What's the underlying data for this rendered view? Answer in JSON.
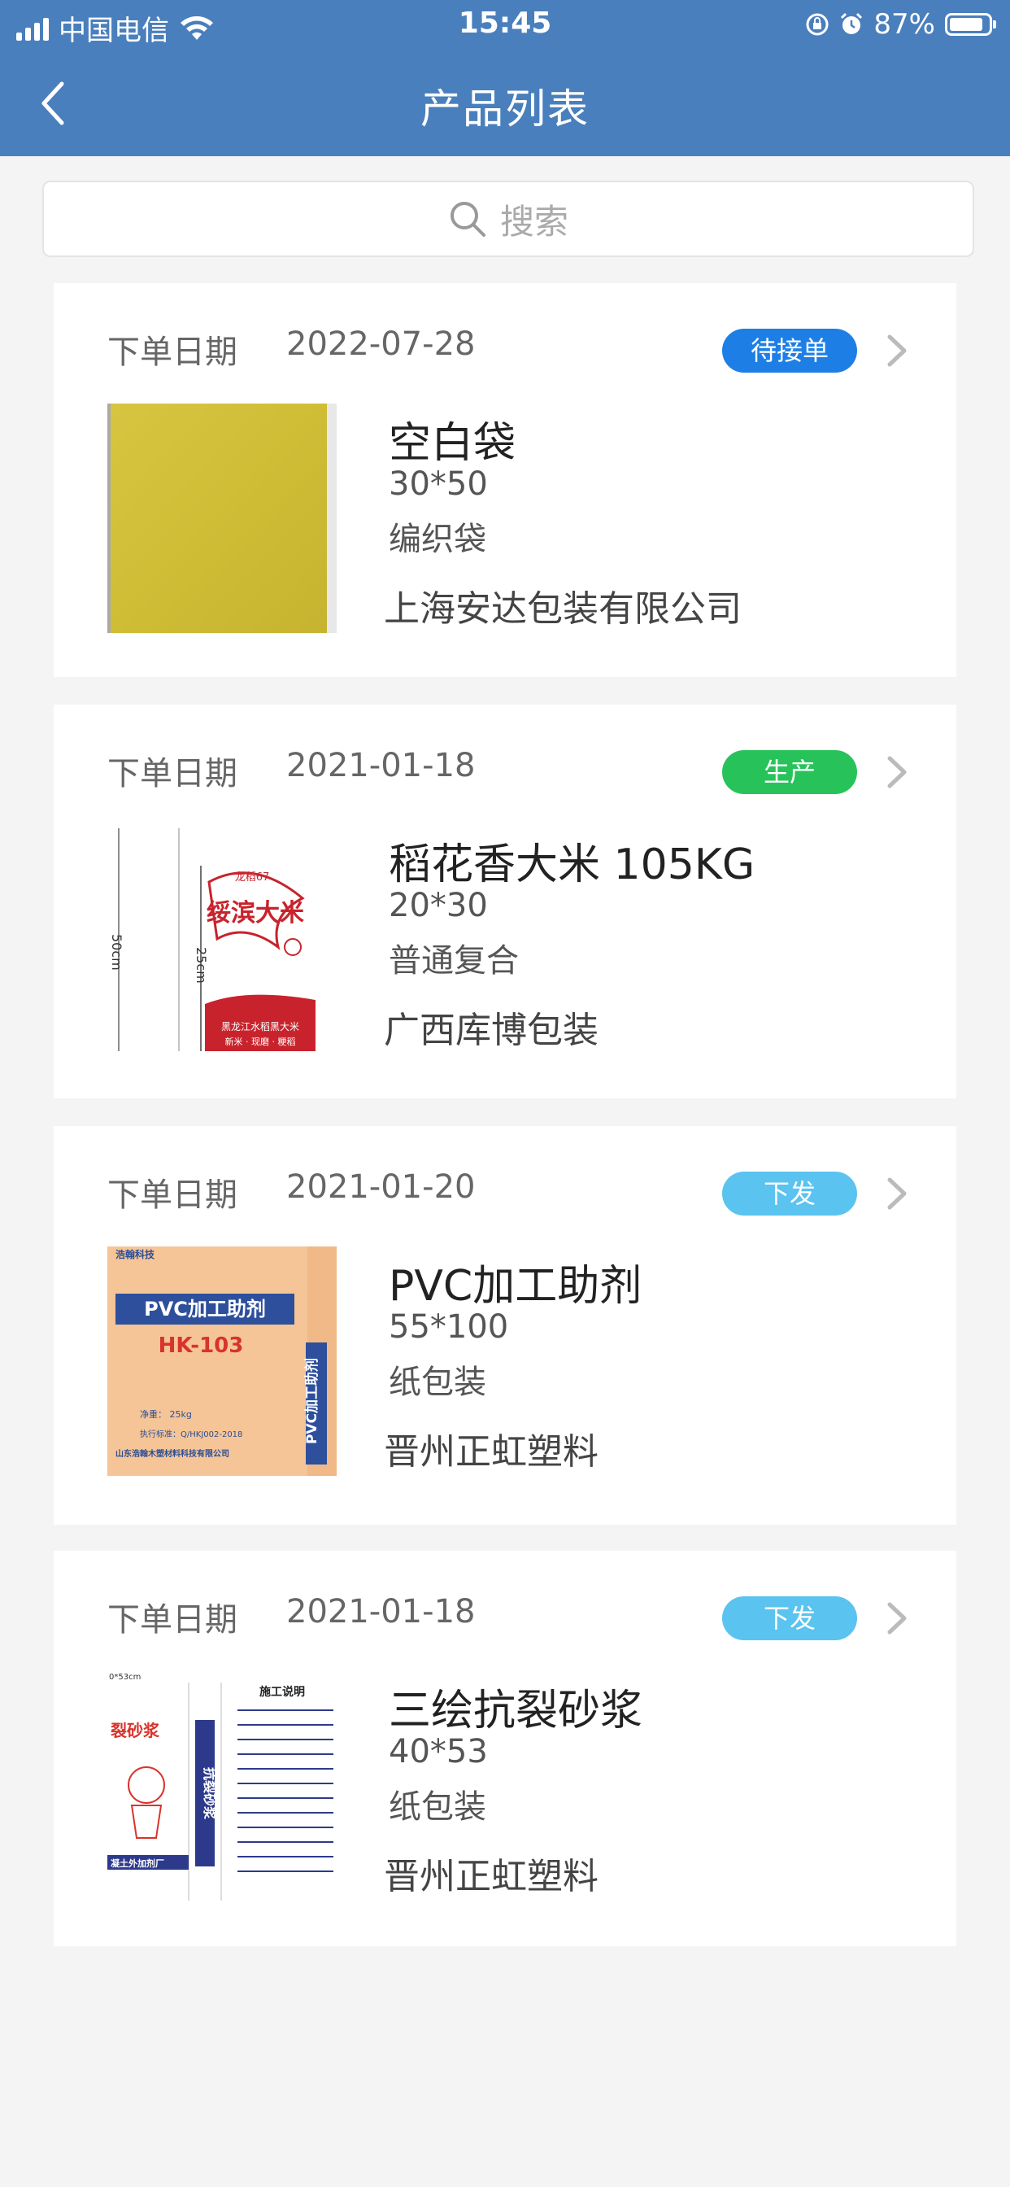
{
  "status_bar": {
    "carrier": "中国电信",
    "time": "15:45",
    "battery": "87%",
    "battery_level": 0.87
  },
  "nav": {
    "title": "产品列表"
  },
  "search": {
    "placeholder": "搜索"
  },
  "colors": {
    "header": "#4a7fbd",
    "badge_pending": "#1d7fe6",
    "badge_production": "#27c35a",
    "badge_dispatch": "#5ac3ef"
  },
  "orders": [
    {
      "date_label": "下单日期",
      "date": "2022-07-28",
      "status": "待接单",
      "name": "空白袋",
      "size": "30*50",
      "type": "编织袋",
      "company": "上海安达包装有限公司"
    },
    {
      "date_label": "下单日期",
      "date": "2021-01-18",
      "status": "生产",
      "name": "稻花香大米 105KG",
      "size": "20*30",
      "type": "普通复合",
      "company": "广西库博包装",
      "thumb_text": {
        "dim_outer": "50cm",
        "dim_inner": "25cm",
        "brand": "绥滨大米",
        "brand_top": "龙稻67",
        "footer": "黑龙江水稻黑大米",
        "footer2": "新米 · 现磨 · 粳稻"
      }
    },
    {
      "date_label": "下单日期",
      "date": "2021-01-20",
      "status": "下发",
      "name": "PVC加工助剂",
      "size": "55*100",
      "type": "纸包装",
      "company": "晋州正虹塑料",
      "thumb_text": {
        "brand": "浩翰科技",
        "title": "PVC加工助剂",
        "model": "HK-103",
        "weight": "净重： 25kg",
        "standard": "执行标准：Q/HKJ002-2018",
        "maker": "山东浩翰木塑材料科技有限公司",
        "side": "PVC加工助剂"
      }
    },
    {
      "date_label": "下单日期",
      "date": "2021-01-18",
      "status": "下发",
      "name": "三绘抗裂砂浆",
      "size": "40*53",
      "type": "纸包装",
      "company": "晋州正虹塑料",
      "thumb_text": {
        "dim": "0*53cm",
        "heading": "施工说明",
        "left": "裂砂浆",
        "vertical": "抗裂砂浆",
        "bottom": "凝土外加剂厂"
      }
    }
  ]
}
